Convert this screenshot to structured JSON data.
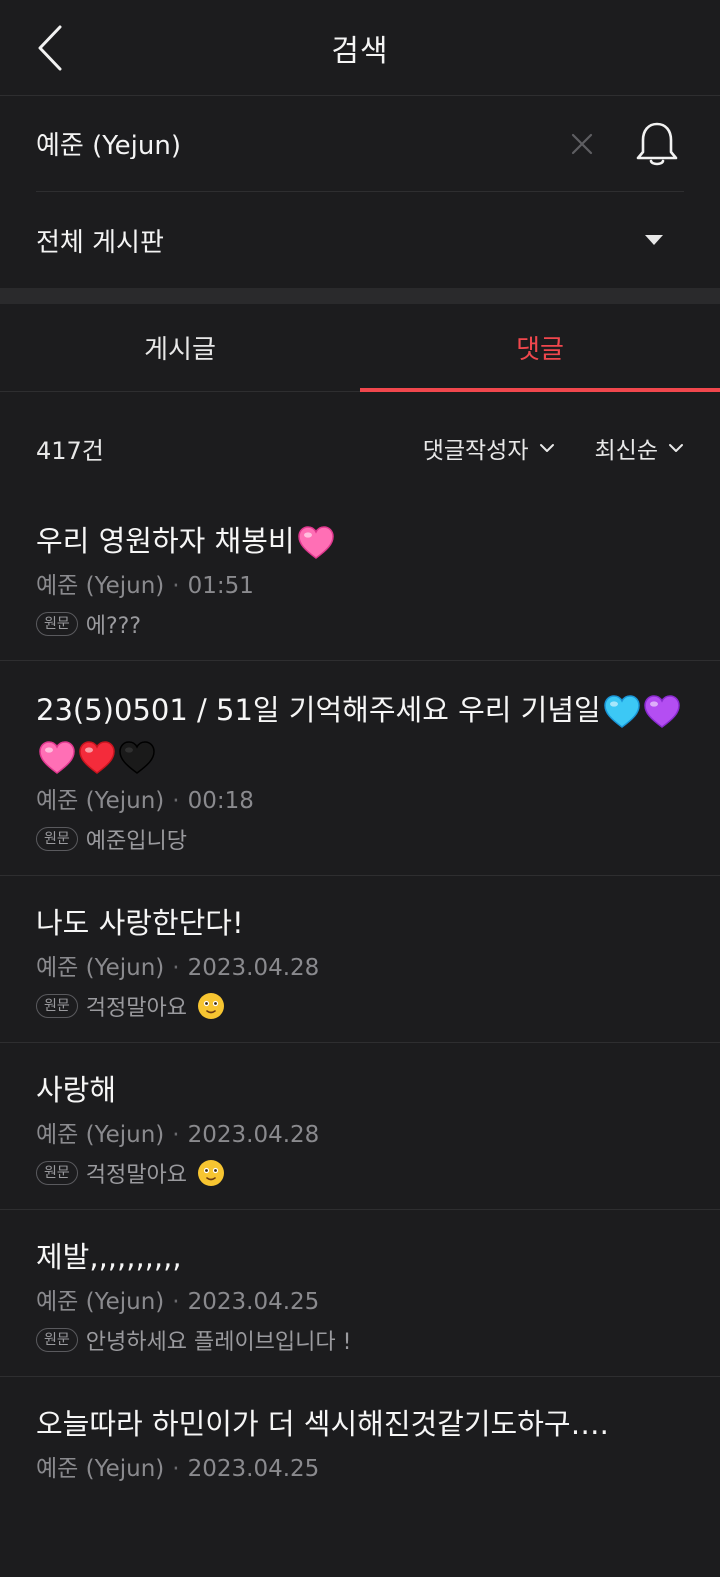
{
  "header": {
    "title": "검색"
  },
  "search": {
    "query": "예준 (Yejun)"
  },
  "board": {
    "selected": "전체 게시판"
  },
  "tabs": [
    {
      "label": "게시글"
    },
    {
      "label": "댓글"
    }
  ],
  "filter": {
    "count": "417건",
    "author_label": "댓글작성자",
    "sort_label": "최신순"
  },
  "items": [
    {
      "title": "우리 영원하자 채봉비",
      "emojis": [
        "pink-heart"
      ],
      "author": "예준 (Yejun)",
      "date": "01:51",
      "badge": "원문",
      "origin": "에???"
    },
    {
      "title": "23(5)0501 / 51일 기억해주세요 우리 기념일",
      "emojis": [
        "blue-heart",
        "purple-heart",
        "pink-heart",
        "red-heart",
        "black-heart"
      ],
      "author": "예준 (Yejun)",
      "date": "00:18",
      "badge": "원문",
      "origin": "예준입니당"
    },
    {
      "title": "나도 사랑한단다!",
      "emojis": [],
      "author": "예준 (Yejun)",
      "date": "2023.04.28",
      "badge": "원문",
      "origin": "걱정말아요",
      "origin_emoji": "smiling-face"
    },
    {
      "title": "사랑해",
      "emojis": [],
      "author": "예준 (Yejun)",
      "date": "2023.04.28",
      "badge": "원문",
      "origin": "걱정말아요",
      "origin_emoji": "smiling-face"
    },
    {
      "title": "제발,,,,,,,,,,",
      "emojis": [],
      "author": "예준 (Yejun)",
      "date": "2023.04.25",
      "badge": "원문",
      "origin": "안녕하세요 플레이브입니다 !"
    },
    {
      "title": "오늘따라 하민이가 더 섹시해진것같기도하구….",
      "emojis": [],
      "author": "예준 (Yejun)",
      "date": "2023.04.25"
    }
  ],
  "colors": {
    "background": "#1c1c1e",
    "accent": "#f0474d",
    "muted": "#8a8a8e"
  }
}
